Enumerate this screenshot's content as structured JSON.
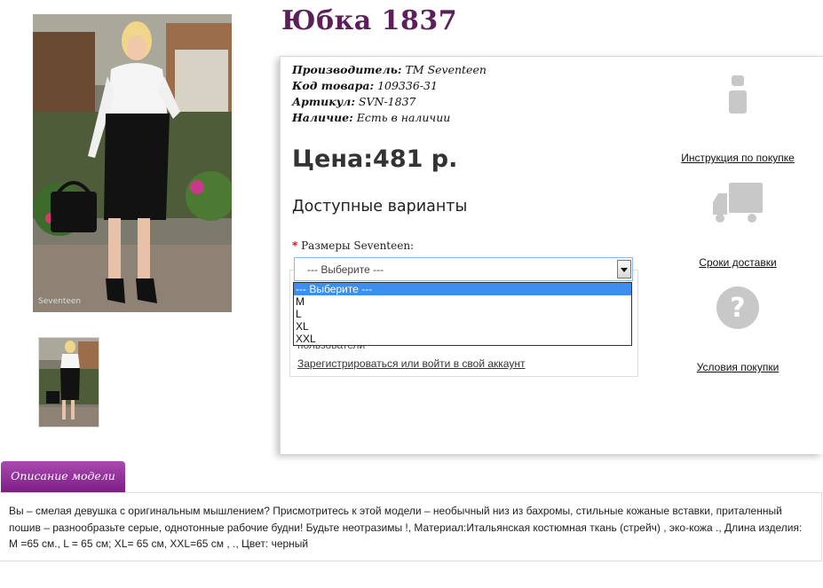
{
  "product": {
    "title": "Юбка 1837",
    "meta": [
      {
        "key": "Производитель:",
        "value": "ТМ Seventeen"
      },
      {
        "key": "Код товара:",
        "value": "109336-31"
      },
      {
        "key": "Артикул:",
        "value": "SVN-1837"
      },
      {
        "key": "Наличие:",
        "value": "Есть в наличии"
      }
    ],
    "price": "Цена:481 р."
  },
  "variants": {
    "heading": "Доступные варианты",
    "required_mark": "*",
    "size_label": "Размеры Seventeen:",
    "selected": "--- Выберите ---",
    "options": [
      "--- Выберите ---",
      "M",
      "L",
      "XL",
      "XXL"
    ]
  },
  "login": {
    "note": "пользователи",
    "link": "Зарегистрироваться или войти в свой аккаунт"
  },
  "sidebar": {
    "items": [
      {
        "icon": "info-icon",
        "label": "Инструкция по покупке"
      },
      {
        "icon": "delivery-truck-icon",
        "label": "Сроки доставки"
      },
      {
        "icon": "question-icon",
        "label": "Условия покупки"
      }
    ]
  },
  "description": {
    "tab_label": "Описание модели",
    "text": "Вы – смелая девушка с оригинальным мышлением? Присмотритесь к этой модели – необычный низ из бахромы, стильные кожаные вставки, приталенный пошив – разнообразьте серые, однотонные рабочие будни! Будьте неотразимы !, Материал:Итальянская костюмная ткань (стрейч) , эко-кожа ., Длина изделия: М =65 см., L = 65 см; XL= 65 см, XXL=65 см , ., Цвет: черный"
  },
  "colors": {
    "title": "#5c1f5a",
    "tab": "#8f2e98",
    "select_highlight": "#3d8ef0",
    "icons": "#c8c8c8"
  }
}
